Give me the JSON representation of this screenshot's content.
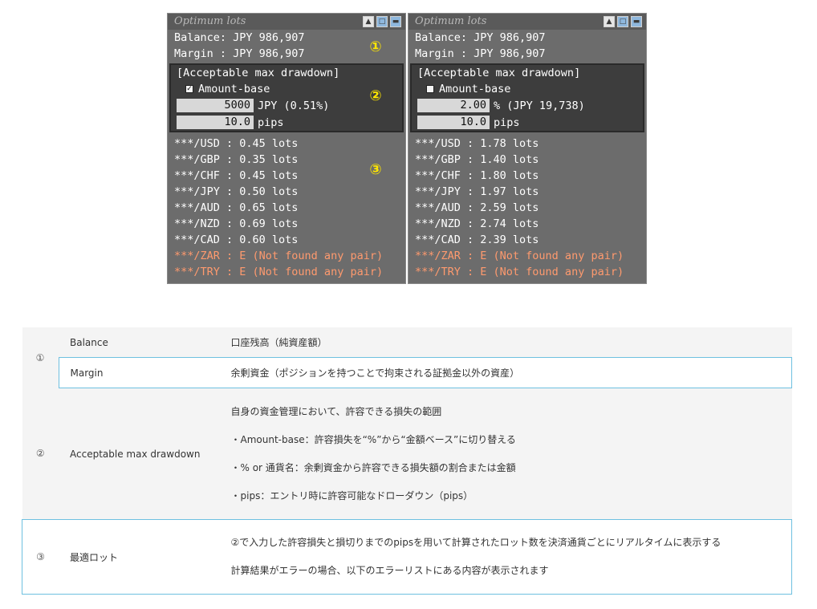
{
  "panel_left": {
    "title": "Optimum lots",
    "balance": "Balance: JPY 986,907",
    "margin": "Margin : JPY 986,907",
    "dd_header": "[Acceptable max drawdown]",
    "amount_base_label": "Amount-base",
    "amount_base_checked": true,
    "amount_value": "5000",
    "amount_after": "JPY (0.51%)",
    "pips_value": "10.0",
    "pips_after": "pips",
    "lots": [
      "***/USD : 0.45 lots",
      "***/GBP : 0.35 lots",
      "***/CHF : 0.45 lots",
      "***/JPY : 0.50 lots",
      "***/AUD : 0.65 lots",
      "***/NZD : 0.69 lots",
      "***/CAD : 0.60 lots"
    ],
    "errors": [
      "***/ZAR : E (Not found any pair)",
      "***/TRY : E (Not found any pair)"
    ],
    "badges": [
      "①",
      "②",
      "③"
    ]
  },
  "panel_right": {
    "title": "Optimum lots",
    "balance": "Balance: JPY 986,907",
    "margin": "Margin : JPY 986,907",
    "dd_header": "[Acceptable max drawdown]",
    "amount_base_label": "Amount-base",
    "amount_base_checked": false,
    "amount_value": "2.00",
    "amount_after": "% (JPY 19,738)",
    "pips_value": "10.0",
    "pips_after": "pips",
    "lots": [
      "***/USD : 1.78 lots",
      "***/GBP : 1.40 lots",
      "***/CHF : 1.80 lots",
      "***/JPY : 1.97 lots",
      "***/AUD : 2.59 lots",
      "***/NZD : 2.74 lots",
      "***/CAD : 2.39 lots"
    ],
    "errors": [
      "***/ZAR : E (Not found any pair)",
      "***/TRY : E (Not found any pair)"
    ]
  },
  "table": {
    "row1": {
      "num": "①",
      "name": "Balance",
      "desc": "口座残高（純資産額）"
    },
    "row2": {
      "name": "Margin",
      "desc": "余剰資金（ポジションを持つことで拘束される証拠金以外の資産）"
    },
    "row3": {
      "num": "②",
      "name": "Acceptable max drawdown",
      "desc": [
        "自身の資金管理において、許容できる損失の範囲",
        "・Amount-base：許容損失を“%”から“金額ベース”に切り替える",
        "・% or 通貨名：余剰資金から許容できる損失額の割合または金額",
        "・pips：エントリ時に許容可能なドローダウン（pips）"
      ]
    },
    "row4": {
      "num": "③",
      "name": "最適ロット",
      "desc": [
        "②で入力した許容損失と損切りまでのpipsを用いて計算されたロット数を決済通貨ごとにリアルタイムに表示する",
        "計算結果がエラーの場合、以下のエラーリストにある内容が表示されます"
      ]
    }
  },
  "window_buttons": [
    "scroll-up-icon",
    "maximize-icon",
    "minimize-icon"
  ],
  "colors": {
    "error": "#ff9a6e",
    "badge": "#ffe600",
    "border_accent": "#6ec0e0"
  }
}
